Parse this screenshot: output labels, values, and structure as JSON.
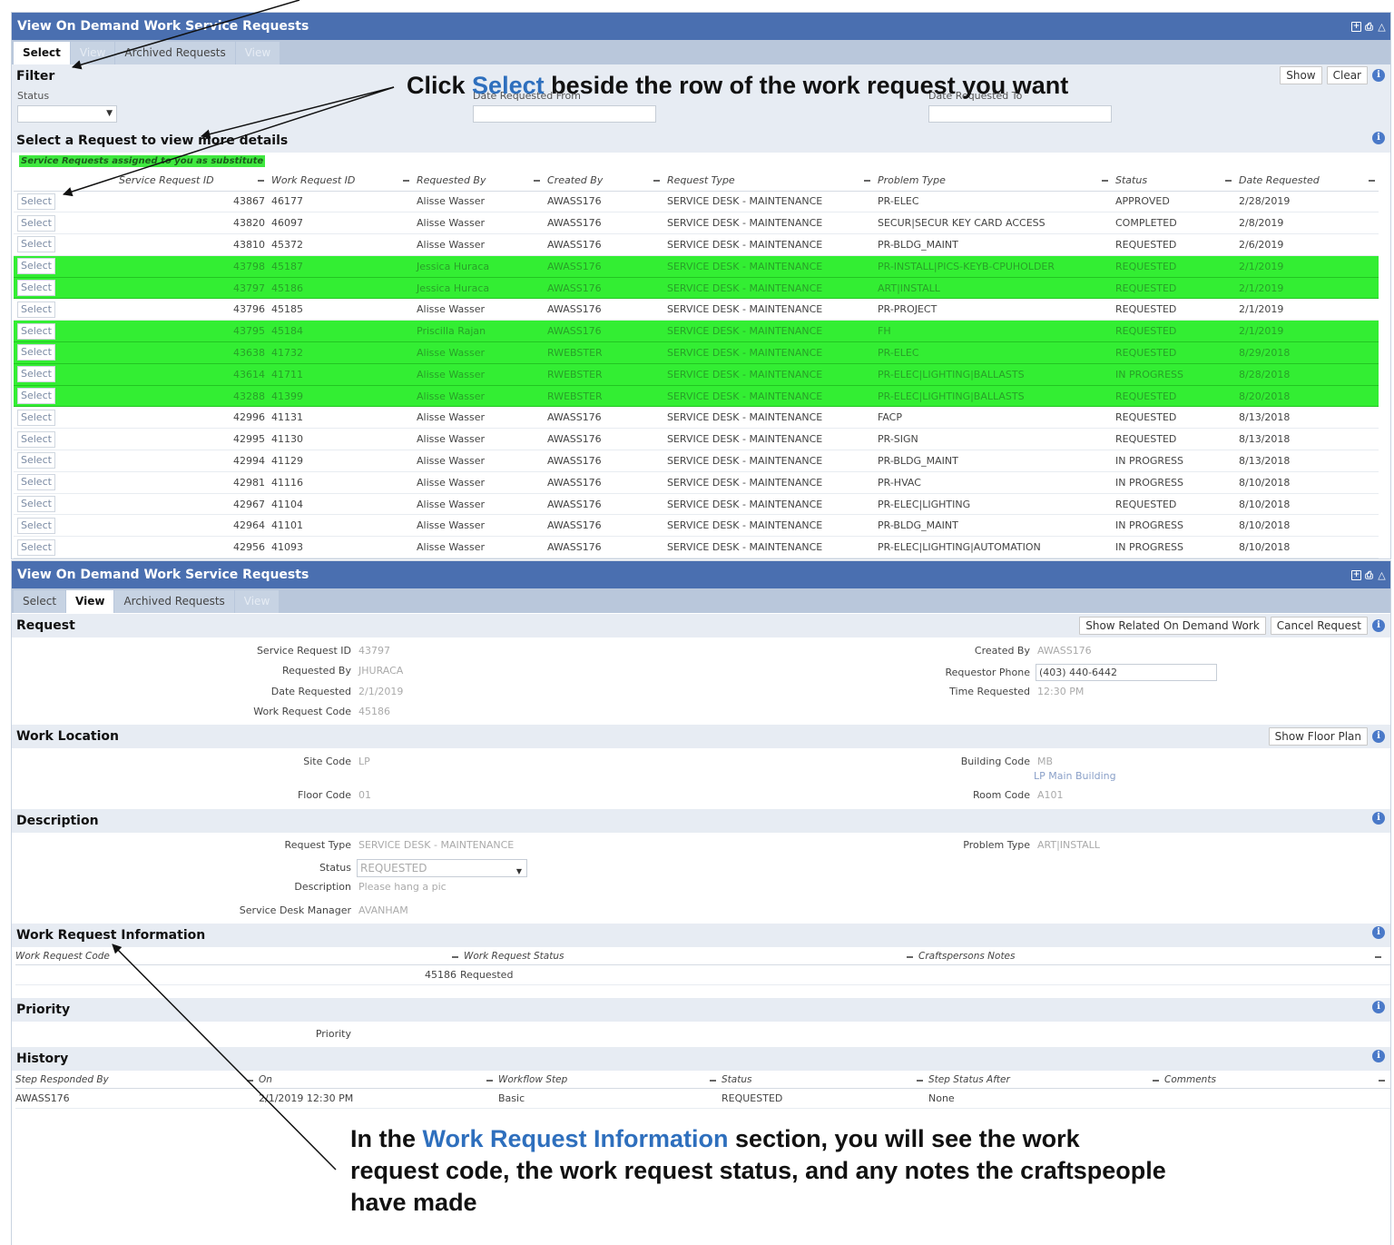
{
  "select_panel": {
    "title": "View On Demand Work Service Requests",
    "tabs": [
      "Select",
      "View",
      "Archived Requests",
      "View"
    ],
    "filter": {
      "heading": "Filter",
      "status_label": "Status",
      "date_from_label": "Date Requested From",
      "date_to_label": "Date Requested To",
      "show_button": "Show",
      "clear_button": "Clear"
    },
    "list_heading": "Select a Request to view more details",
    "substitute_note": "Service Requests assigned to you as substitute",
    "columns": [
      "Service Request ID",
      "Work Request ID",
      "Requested By",
      "Created By",
      "Request Type",
      "Problem Type",
      "Status",
      "Date Requested"
    ],
    "select_label": "Select",
    "rows": [
      {
        "sr": "43867",
        "wr": "46177",
        "by": "Alisse Wasser",
        "created": "AWASS176",
        "type": "SERVICE DESK - MAINTENANCE",
        "problem": "PR-ELEC",
        "status": "APPROVED",
        "date": "2/28/2019",
        "highlight": false
      },
      {
        "sr": "43820",
        "wr": "46097",
        "by": "Alisse Wasser",
        "created": "AWASS176",
        "type": "SERVICE DESK - MAINTENANCE",
        "problem": "SECUR|SECUR KEY CARD ACCESS",
        "status": "COMPLETED",
        "date": "2/8/2019",
        "highlight": false
      },
      {
        "sr": "43810",
        "wr": "45372",
        "by": "Alisse Wasser",
        "created": "AWASS176",
        "type": "SERVICE DESK - MAINTENANCE",
        "problem": "PR-BLDG_MAINT",
        "status": "REQUESTED",
        "date": "2/6/2019",
        "highlight": false
      },
      {
        "sr": "43798",
        "wr": "45187",
        "by": "Jessica Huraca",
        "created": "AWASS176",
        "type": "SERVICE DESK - MAINTENANCE",
        "problem": "PR-INSTALL|PICS-KEYB-CPUHOLDER",
        "status": "REQUESTED",
        "date": "2/1/2019",
        "highlight": true
      },
      {
        "sr": "43797",
        "wr": "45186",
        "by": "Jessica Huraca",
        "created": "AWASS176",
        "type": "SERVICE DESK - MAINTENANCE",
        "problem": "ART|INSTALL",
        "status": "REQUESTED",
        "date": "2/1/2019",
        "highlight": true
      },
      {
        "sr": "43796",
        "wr": "45185",
        "by": "Alisse Wasser",
        "created": "AWASS176",
        "type": "SERVICE DESK - MAINTENANCE",
        "problem": "PR-PROJECT",
        "status": "REQUESTED",
        "date": "2/1/2019",
        "highlight": false
      },
      {
        "sr": "43795",
        "wr": "45184",
        "by": "Priscilla Rajan",
        "created": "AWASS176",
        "type": "SERVICE DESK - MAINTENANCE",
        "problem": "FH",
        "status": "REQUESTED",
        "date": "2/1/2019",
        "highlight": true
      },
      {
        "sr": "43638",
        "wr": "41732",
        "by": "Alisse Wasser",
        "created": "RWEBSTER",
        "type": "SERVICE DESK - MAINTENANCE",
        "problem": "PR-ELEC",
        "status": "REQUESTED",
        "date": "8/29/2018",
        "highlight": true
      },
      {
        "sr": "43614",
        "wr": "41711",
        "by": "Alisse Wasser",
        "created": "RWEBSTER",
        "type": "SERVICE DESK - MAINTENANCE",
        "problem": "PR-ELEC|LIGHTING|BALLASTS",
        "status": "IN PROGRESS",
        "date": "8/28/2018",
        "highlight": true
      },
      {
        "sr": "43288",
        "wr": "41399",
        "by": "Alisse Wasser",
        "created": "RWEBSTER",
        "type": "SERVICE DESK - MAINTENANCE",
        "problem": "PR-ELEC|LIGHTING|BALLASTS",
        "status": "REQUESTED",
        "date": "8/20/2018",
        "highlight": true
      },
      {
        "sr": "42996",
        "wr": "41131",
        "by": "Alisse Wasser",
        "created": "AWASS176",
        "type": "SERVICE DESK - MAINTENANCE",
        "problem": "FACP",
        "status": "REQUESTED",
        "date": "8/13/2018",
        "highlight": false
      },
      {
        "sr": "42995",
        "wr": "41130",
        "by": "Alisse Wasser",
        "created": "AWASS176",
        "type": "SERVICE DESK - MAINTENANCE",
        "problem": "PR-SIGN",
        "status": "REQUESTED",
        "date": "8/13/2018",
        "highlight": false
      },
      {
        "sr": "42994",
        "wr": "41129",
        "by": "Alisse Wasser",
        "created": "AWASS176",
        "type": "SERVICE DESK - MAINTENANCE",
        "problem": "PR-BLDG_MAINT",
        "status": "IN PROGRESS",
        "date": "8/13/2018",
        "highlight": false
      },
      {
        "sr": "42981",
        "wr": "41116",
        "by": "Alisse Wasser",
        "created": "AWASS176",
        "type": "SERVICE DESK - MAINTENANCE",
        "problem": "PR-HVAC",
        "status": "IN PROGRESS",
        "date": "8/10/2018",
        "highlight": false
      },
      {
        "sr": "42967",
        "wr": "41104",
        "by": "Alisse Wasser",
        "created": "AWASS176",
        "type": "SERVICE DESK - MAINTENANCE",
        "problem": "PR-ELEC|LIGHTING",
        "status": "REQUESTED",
        "date": "8/10/2018",
        "highlight": false
      },
      {
        "sr": "42964",
        "wr": "41101",
        "by": "Alisse Wasser",
        "created": "AWASS176",
        "type": "SERVICE DESK - MAINTENANCE",
        "problem": "PR-BLDG_MAINT",
        "status": "IN PROGRESS",
        "date": "8/10/2018",
        "highlight": false
      },
      {
        "sr": "42956",
        "wr": "41093",
        "by": "Alisse Wasser",
        "created": "AWASS176",
        "type": "SERVICE DESK - MAINTENANCE",
        "problem": "PR-ELEC|LIGHTING|AUTOMATION",
        "status": "IN PROGRESS",
        "date": "8/10/2018",
        "highlight": false
      }
    ]
  },
  "view_panel": {
    "title": "View On Demand Work Service Requests",
    "tabs": [
      "Select",
      "View",
      "Archived Requests",
      "View"
    ],
    "request": {
      "heading": "Request",
      "show_related_button": "Show Related On Demand Work",
      "cancel_button": "Cancel Request",
      "fields": {
        "sr_id_label": "Service Request ID",
        "sr_id": "43797",
        "requested_by_label": "Requested By",
        "requested_by": "JHURACA",
        "date_requested_label": "Date Requested",
        "date_requested": "2/1/2019",
        "wr_code_label": "Work Request Code",
        "wr_code": "45186",
        "created_by_label": "Created By",
        "created_by": "AWASS176",
        "phone_label": "Requestor Phone",
        "phone": "(403) 440-6442",
        "time_label": "Time Requested",
        "time": "12:30 PM"
      }
    },
    "location": {
      "heading": "Work Location",
      "floor_plan_button": "Show Floor Plan",
      "site_label": "Site Code",
      "site": "LP",
      "floor_label": "Floor Code",
      "floor": "01",
      "building_label": "Building Code",
      "building": "MB",
      "building_name": "LP Main Building",
      "room_label": "Room Code",
      "room": "A101"
    },
    "description": {
      "heading": "Description",
      "type_label": "Request Type",
      "type": "SERVICE DESK - MAINTENANCE",
      "status_label": "Status",
      "status": "REQUESTED",
      "desc_label": "Description",
      "desc": "Please hang a pic",
      "manager_label": "Service Desk Manager",
      "manager": "AVANHAM",
      "problem_label": "Problem Type",
      "problem": "ART|INSTALL"
    },
    "work_info": {
      "heading": "Work Request Information",
      "columns": [
        "Work Request Code",
        "Work Request Status",
        "Craftspersons Notes"
      ],
      "row": {
        "code": "45186",
        "status": "Requested",
        "notes": ""
      }
    },
    "priority": {
      "heading": "Priority",
      "label": "Priority"
    },
    "history": {
      "heading": "History",
      "columns": [
        "Step Responded By",
        "On",
        "Workflow Step",
        "Status",
        "Step Status After",
        "Comments"
      ],
      "row": {
        "by": "AWASS176",
        "on": "2/1/2019 12:30 PM",
        "step": "Basic",
        "status": "REQUESTED",
        "after": "None",
        "comments": ""
      }
    }
  },
  "annotations": {
    "top_pre": "Click ",
    "top_keyword": "Select",
    "top_post": " beside the row of the work request you want",
    "bottom_pre": "In the ",
    "bottom_keyword": "Work Request Information",
    "bottom_post": " section, you will see the work request code, the work request status, and any notes the craftspeople have made"
  },
  "colors": {
    "header": "#4a6fb0",
    "highlight_row": "#33ee33",
    "annotation_blue": "#2e6fbd"
  }
}
